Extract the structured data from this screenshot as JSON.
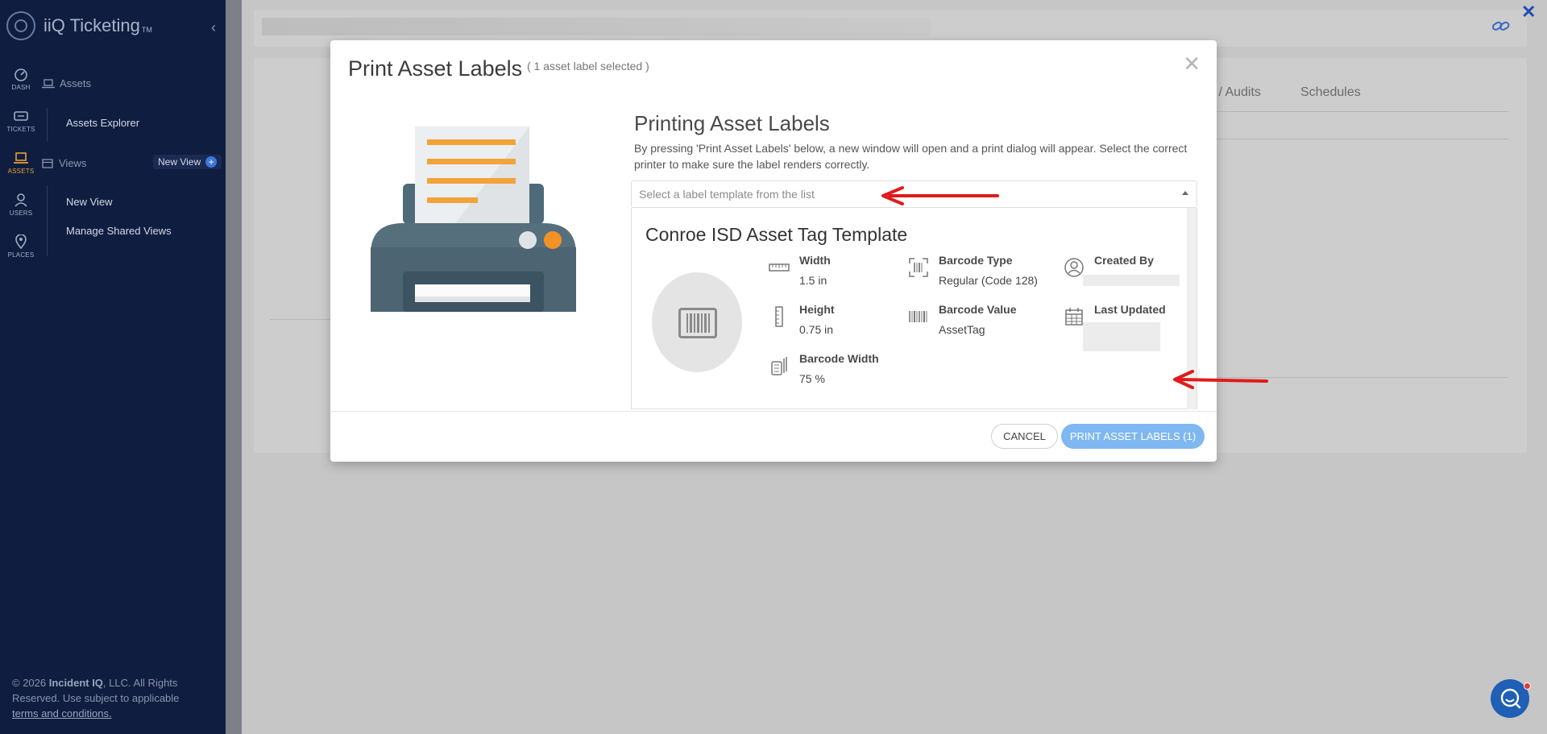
{
  "app": {
    "brand_name": "iiQ Ticketing",
    "brand_tm": "TM"
  },
  "sidebar": {
    "rail": [
      {
        "label": "DASH",
        "icon": "dashboard-icon"
      },
      {
        "label": "TICKETS",
        "icon": "tickets-icon"
      },
      {
        "label": "ASSETS",
        "icon": "laptop-icon"
      },
      {
        "label": "USERS",
        "icon": "user-icon"
      },
      {
        "label": "PLACES",
        "icon": "map-pin-icon"
      }
    ],
    "assets_section": "Assets",
    "assets_explorer": "Assets Explorer",
    "views_section": "Views",
    "new_view_button": "New View",
    "new_view_item": "New View",
    "manage_shared_views": "Manage Shared Views",
    "footer": {
      "copyright_prefix": "© 2026",
      "company": "Incident IQ",
      "copyright_suffix": ", LLC. All Rights Reserved. Use subject to applicable",
      "terms_link": "terms and conditions."
    }
  },
  "background": {
    "tabs": [
      "s / Audits",
      "Schedules"
    ]
  },
  "modal": {
    "title": "Print Asset Labels",
    "subtitle": "( 1 asset label selected )",
    "section_title": "Printing Asset Labels",
    "description": "By pressing 'Print Asset Labels' below, a new window will open and a print dialog will appear. Select the correct printer to make sure the label renders correctly.",
    "select_placeholder": "Select a label template from the list",
    "template": {
      "name": "Conroe ISD Asset Tag Template",
      "width_label": "Width",
      "width_value": "1.5 in",
      "height_label": "Height",
      "height_value": "0.75 in",
      "barcode_width_label": "Barcode Width",
      "barcode_width_value": "75 %",
      "barcode_type_label": "Barcode Type",
      "barcode_type_value": "Regular (Code 128)",
      "barcode_value_label": "Barcode Value",
      "barcode_value_value": "AssetTag",
      "created_by_label": "Created By",
      "last_updated_label": "Last Updated"
    },
    "cancel_label": "CANCEL",
    "print_label": "PRINT ASSET LABELS (1)"
  },
  "colors": {
    "sidebar_bg": "#0f1d40",
    "accent_orange": "#e8a135",
    "primary_button": "#7fb8f0",
    "annotation_arrow": "#e01b1b"
  }
}
